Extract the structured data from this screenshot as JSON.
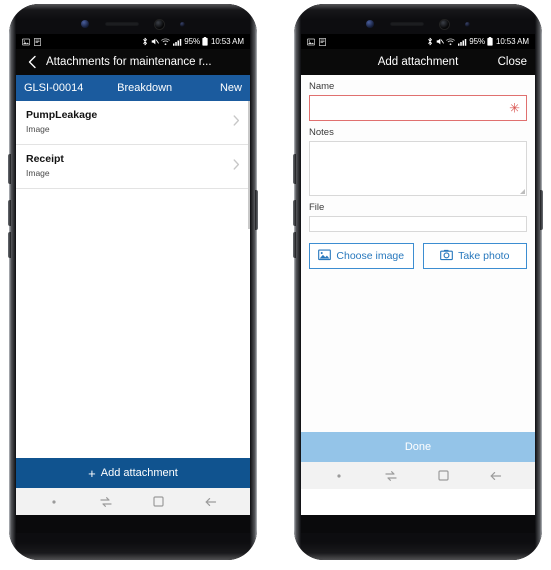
{
  "status_bar": {
    "icons_left": [
      "image-icon",
      "document-icon"
    ],
    "bluetooth": "bluetooth-icon",
    "mute": "mute-icon",
    "wifi": "wifi-icon",
    "signal": "signal-icon",
    "battery_percent": "95%",
    "battery": "battery-icon",
    "time": "10:53 AM"
  },
  "left_phone": {
    "appbar": {
      "back_icon": "chevron-left-icon",
      "title": "Attachments for maintenance r..."
    },
    "record": {
      "id": "GLSI-00014",
      "type": "Breakdown",
      "status": "New"
    },
    "list": [
      {
        "name": "PumpLeakage",
        "type": "Image",
        "chevron": "chevron-right-icon"
      },
      {
        "name": "Receipt",
        "type": "Image",
        "chevron": "chevron-right-icon"
      }
    ],
    "action": {
      "plus": "+",
      "label": "Add attachment"
    }
  },
  "right_phone": {
    "appbar": {
      "title": "Add attachment",
      "close_label": "Close"
    },
    "form": {
      "name_label": "Name",
      "name_value": "",
      "name_required_marker": "✳",
      "notes_label": "Notes",
      "notes_value": "",
      "file_label": "File",
      "file_value": "",
      "choose_image_label": "Choose image",
      "choose_image_icon": "picture-icon",
      "take_photo_label": "Take photo",
      "take_photo_icon": "camera-icon"
    },
    "action": {
      "label": "Done"
    }
  },
  "nav_bar": {
    "items": [
      "dot-icon",
      "recents-icon",
      "home-icon",
      "back-arrow-icon"
    ]
  },
  "colors": {
    "accent_blue": "#1b5b9e",
    "action_blue": "#10538f",
    "disabled_blue": "#94c4e8",
    "button_blue": "#2878bd",
    "required_red": "#d9534f"
  }
}
